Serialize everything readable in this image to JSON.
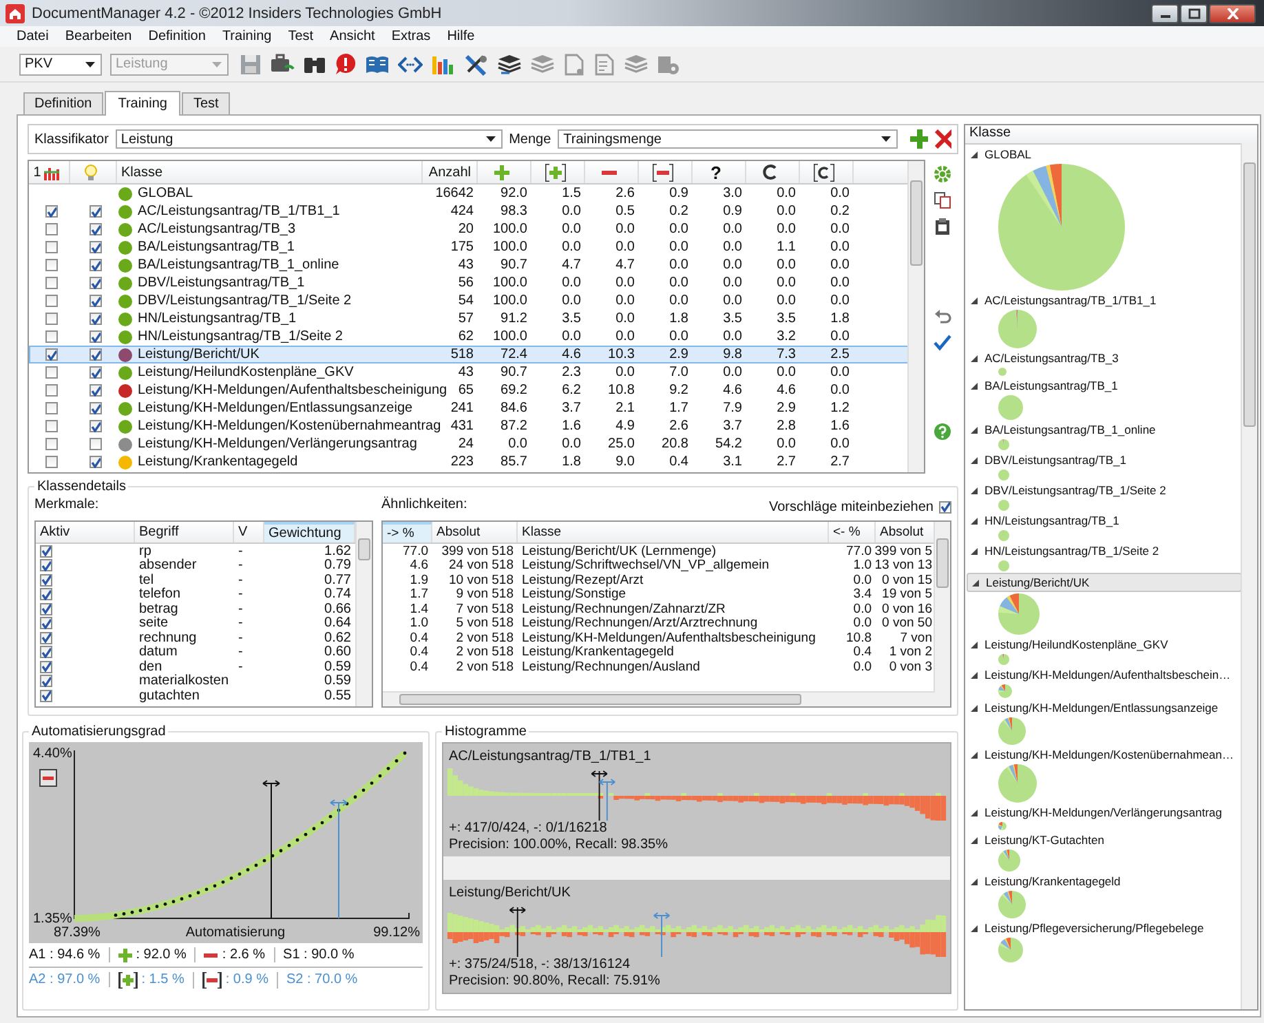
{
  "window": {
    "title": "DocumentManager 4.2 - ©2012 Insiders Technologies GmbH"
  },
  "menu": [
    "Datei",
    "Bearbeiten",
    "Definition",
    "Training",
    "Test",
    "Ansicht",
    "Extras",
    "Hilfe"
  ],
  "toolbar": {
    "combos": [
      {
        "value": "PKV",
        "disabled": false
      },
      {
        "value": "Leistung",
        "disabled": true
      }
    ]
  },
  "tabs": [
    {
      "label": "Definition",
      "selected": false
    },
    {
      "label": "Training",
      "selected": true
    },
    {
      "label": "Test",
      "selected": false
    }
  ],
  "classifier": {
    "label": "Klassifikator",
    "value": "Leistung",
    "set_label": "Menge",
    "set_value": "Trainingsmenge"
  },
  "table": {
    "columns": [
      {
        "kind": "count-icon",
        "label": "1"
      },
      {
        "kind": "bulb"
      },
      {
        "kind": "text",
        "label": "Klasse"
      },
      {
        "kind": "text",
        "label": "Anzahl"
      },
      {
        "kind": "plus"
      },
      {
        "kind": "plus-boxed"
      },
      {
        "kind": "minus"
      },
      {
        "kind": "minus-boxed"
      },
      {
        "kind": "text",
        "label": "?"
      },
      {
        "kind": "c"
      },
      {
        "kind": "c-boxed"
      }
    ],
    "rows": [
      {
        "kind": "total",
        "name": "GLOBAL",
        "color": "#6aaa1a",
        "count": "16642",
        "values": [
          "92.0",
          "1.5",
          "2.6",
          "0.9",
          "3.0",
          "0.0",
          "0.0"
        ],
        "selected": false
      },
      {
        "kind": "class",
        "name": "AC/Leistungsantrag/TB_1/TB1_1",
        "color": "#6aaa1a",
        "count": "424",
        "values": [
          "98.3",
          "0.0",
          "0.5",
          "0.2",
          "0.9",
          "0.0",
          "0.2"
        ],
        "checked_1": true,
        "checked_2": true,
        "selected": false
      },
      {
        "kind": "class",
        "name": "AC/Leistungsantrag/TB_3",
        "color": "#6aaa1a",
        "count": "20",
        "values": [
          "100.0",
          "0.0",
          "0.0",
          "0.0",
          "0.0",
          "0.0",
          "0.0"
        ],
        "checked_1": false,
        "checked_2": true,
        "selected": false
      },
      {
        "kind": "class",
        "name": "BA/Leistungsantrag/TB_1",
        "color": "#6aaa1a",
        "count": "175",
        "values": [
          "100.0",
          "0.0",
          "0.0",
          "0.0",
          "0.0",
          "1.1",
          "0.0"
        ],
        "checked_1": false,
        "checked_2": true,
        "selected": false
      },
      {
        "kind": "class",
        "name": "BA/Leistungsantrag/TB_1_online",
        "color": "#6aaa1a",
        "count": "43",
        "values": [
          "90.7",
          "4.7",
          "4.7",
          "0.0",
          "0.0",
          "0.0",
          "0.0"
        ],
        "checked_1": false,
        "checked_2": true,
        "selected": false
      },
      {
        "kind": "class",
        "name": "DBV/Leistungsantrag/TB_1",
        "color": "#6aaa1a",
        "count": "56",
        "values": [
          "100.0",
          "0.0",
          "0.0",
          "0.0",
          "0.0",
          "0.0",
          "0.0"
        ],
        "checked_1": false,
        "checked_2": true,
        "selected": false
      },
      {
        "kind": "class",
        "name": "DBV/Leistungsantrag/TB_1/Seite 2",
        "color": "#6aaa1a",
        "count": "54",
        "values": [
          "100.0",
          "0.0",
          "0.0",
          "0.0",
          "0.0",
          "0.0",
          "0.0"
        ],
        "checked_1": false,
        "checked_2": true,
        "selected": false
      },
      {
        "kind": "class",
        "name": "HN/Leistungsantrag/TB_1",
        "color": "#6aaa1a",
        "count": "57",
        "values": [
          "91.2",
          "3.5",
          "0.0",
          "1.8",
          "3.5",
          "3.5",
          "1.8"
        ],
        "checked_1": false,
        "checked_2": true,
        "selected": false
      },
      {
        "kind": "class",
        "name": "HN/Leistungsantrag/TB_1/Seite 2",
        "color": "#6aaa1a",
        "count": "62",
        "values": [
          "100.0",
          "0.0",
          "0.0",
          "0.0",
          "0.0",
          "3.2",
          "0.0"
        ],
        "checked_1": false,
        "checked_2": true,
        "selected": false
      },
      {
        "kind": "class",
        "name": "Leistung/Bericht/UK",
        "color": "#8e4a6e",
        "count": "518",
        "values": [
          "72.4",
          "4.6",
          "10.3",
          "2.9",
          "9.8",
          "7.3",
          "2.5"
        ],
        "checked_1": true,
        "checked_2": true,
        "selected": true
      },
      {
        "kind": "class",
        "name": "Leistung/HeilundKostenpläne_GKV",
        "color": "#6aaa1a",
        "count": "43",
        "values": [
          "90.7",
          "2.3",
          "0.0",
          "7.0",
          "0.0",
          "0.0",
          "0.0"
        ],
        "checked_1": false,
        "checked_2": true,
        "selected": false
      },
      {
        "kind": "class",
        "name": "Leistung/KH-Meldungen/Aufenthaltsbescheinigung",
        "color": "#c62828",
        "count": "65",
        "values": [
          "69.2",
          "6.2",
          "10.8",
          "9.2",
          "4.6",
          "4.6",
          "0.0"
        ],
        "checked_1": false,
        "checked_2": true,
        "selected": false
      },
      {
        "kind": "class",
        "name": "Leistung/KH-Meldungen/Entlassungsanzeige",
        "color": "#6aaa1a",
        "count": "241",
        "values": [
          "84.6",
          "3.7",
          "2.1",
          "1.7",
          "7.9",
          "2.9",
          "1.2"
        ],
        "checked_1": false,
        "checked_2": true,
        "selected": false
      },
      {
        "kind": "class",
        "name": "Leistung/KH-Meldungen/Kostenübernahmeantrag",
        "color": "#6aaa1a",
        "count": "431",
        "values": [
          "87.2",
          "1.6",
          "4.9",
          "2.6",
          "3.7",
          "2.8",
          "1.6"
        ],
        "checked_1": false,
        "checked_2": true,
        "selected": false
      },
      {
        "kind": "class",
        "name": "Leistung/KH-Meldungen/Verlängerungsantrag",
        "color": "#8c8c8c",
        "count": "24",
        "values": [
          "0.0",
          "0.0",
          "25.0",
          "20.8",
          "54.2",
          "0.0",
          "0.0"
        ],
        "checked_1": false,
        "checked_2": false,
        "selected": false
      },
      {
        "kind": "class",
        "name": "Leistung/Krankentagegeld",
        "color": "#f5b800",
        "count": "223",
        "values": [
          "85.7",
          "1.8",
          "9.0",
          "0.4",
          "3.1",
          "2.7",
          "2.7"
        ],
        "checked_1": false,
        "checked_2": true,
        "selected": false
      }
    ]
  },
  "details": {
    "title": "Klassendetails",
    "features_label": "Merkmale:",
    "features_columns": [
      {
        "label": "Aktiv",
        "sorted": false
      },
      {
        "label": "Begriff",
        "sorted": false
      },
      {
        "label": "V",
        "sorted": false
      },
      {
        "label": "Gewichtung",
        "sorted": true
      }
    ],
    "features": [
      {
        "checked": true,
        "term": "rp",
        "v": "-",
        "weight": "1.62"
      },
      {
        "checked": true,
        "term": "absender",
        "v": "-",
        "weight": "0.79"
      },
      {
        "checked": true,
        "term": "tel",
        "v": "-",
        "weight": "0.77"
      },
      {
        "checked": true,
        "term": "telefon",
        "v": "-",
        "weight": "0.74"
      },
      {
        "checked": true,
        "term": "betrag",
        "v": "-",
        "weight": "0.66"
      },
      {
        "checked": true,
        "term": "seite",
        "v": "-",
        "weight": "0.64"
      },
      {
        "checked": true,
        "term": "rechnung",
        "v": "-",
        "weight": "0.62"
      },
      {
        "checked": true,
        "term": "datum",
        "v": "-",
        "weight": "0.60"
      },
      {
        "checked": true,
        "term": "den",
        "v": "-",
        "weight": "0.59"
      },
      {
        "checked": true,
        "term": "materialkosten",
        "weight": "0.59"
      },
      {
        "checked": true,
        "term": "gutachten",
        "weight": "0.55"
      }
    ],
    "similar_label": "Ähnlichkeiten:",
    "suggest_label": "Vorschläge miteinbeziehen",
    "suggest_checked": true,
    "similar_columns": [
      {
        "label": "-> %",
        "sorted": true
      },
      {
        "label": "Absolut",
        "sorted": false
      },
      {
        "label": "Klasse",
        "sorted": false
      },
      {
        "label": "<- %",
        "sorted": false
      },
      {
        "label": "Absolut",
        "sorted": false
      }
    ],
    "similar": [
      {
        "pct_to": "77.0",
        "abs_to": "399 von 518",
        "class": "Leistung/Bericht/UK (Lernmenge)",
        "pct_from": "77.0",
        "abs_from": "399 von 5"
      },
      {
        "pct_to": "4.6",
        "abs_to": "24 von 518",
        "class": "Leistung/Schriftwechsel/VN_VP_allgemein",
        "pct_from": "1.0",
        "abs_from": "13 von 13"
      },
      {
        "pct_to": "1.9",
        "abs_to": "10 von 518",
        "class": "Leistung/Rezept/Arzt",
        "pct_from": "0.0",
        "abs_from": "0 von 15"
      },
      {
        "pct_to": "1.7",
        "abs_to": "9 von 518",
        "class": "Leistung/Sonstige",
        "pct_from": "3.4",
        "abs_from": "19 von 5"
      },
      {
        "pct_to": "1.4",
        "abs_to": "7 von 518",
        "class": "Leistung/Rechnungen/Zahnarzt/ZR",
        "pct_from": "0.0",
        "abs_from": "0 von 16"
      },
      {
        "pct_to": "1.0",
        "abs_to": "5 von 518",
        "class": "Leistung/Rechnungen/Arzt/Arztrechnung",
        "pct_from": "0.0",
        "abs_from": "0 von 50"
      },
      {
        "pct_to": "0.4",
        "abs_to": "2 von 518",
        "class": "Leistung/KH-Meldungen/Aufenthaltsbescheinigung",
        "pct_from": "10.8",
        "abs_from": "7 von"
      },
      {
        "pct_to": "0.4",
        "abs_to": "2 von 518",
        "class": "Leistung/Krankentagegeld",
        "pct_from": "0.4",
        "abs_from": "1 von 2"
      },
      {
        "pct_to": "0.4",
        "abs_to": "2 von 518",
        "class": "Leistung/Rechnungen/Ausland",
        "pct_from": "0.0",
        "abs_from": "0 von 3"
      }
    ]
  },
  "automation": {
    "title": "Automatisierungsgrad",
    "y_max": "4.40%",
    "y_min": "1.35%",
    "x_min": "87.39%",
    "x_max": "99.12%",
    "xlabel": "Automatisierung",
    "stats": [
      {
        "kind": "primary",
        "items": [
          {
            "kind": "label",
            "text": "A1 : 94.6 %"
          },
          {
            "kind": "plus",
            "text": ": 92.0 %"
          },
          {
            "kind": "minus",
            "text": ": 2.6 %"
          },
          {
            "kind": "label",
            "text": "S1 : 90.0 %"
          }
        ]
      },
      {
        "kind": "secondary",
        "items": [
          {
            "kind": "label",
            "text": "A2 : 97.0 %"
          },
          {
            "kind": "bracketed-plus",
            "text": ": 1.5 %"
          },
          {
            "kind": "bracketed-minus",
            "text": ": 0.9 %"
          },
          {
            "kind": "label",
            "text": "S2 : 70.0 %"
          }
        ]
      }
    ]
  },
  "histograms": {
    "title": "Histogramme",
    "items": [
      {
        "name": "AC/Leistungsantrag/TB_1/TB1_1",
        "counts": "+: 417/0/424, -: 0/1/16218",
        "metrics": "Precision: 100.00%, Recall: 98.35%"
      },
      {
        "name": "Leistung/Bericht/UK",
        "counts": "+: 375/24/518, -: 38/13/16124",
        "metrics": "Precision: 90.80%, Recall: 75.91%"
      }
    ]
  },
  "class_tree": {
    "header": "Klasse",
    "items": [
      {
        "label": "GLOBAL",
        "expanded": true,
        "selected": false
      },
      {
        "label": "AC/Leistungsantrag/TB_1/TB1_1",
        "expanded": true,
        "selected": false
      },
      {
        "label": "AC/Leistungsantrag/TB_3",
        "expanded": true,
        "selected": false
      },
      {
        "label": "BA/Leistungsantrag/TB_1",
        "expanded": true,
        "selected": false
      },
      {
        "label": "BA/Leistungsantrag/TB_1_online",
        "expanded": true,
        "selected": false
      },
      {
        "label": "DBV/Leistungsantrag/TB_1",
        "expanded": true,
        "selected": false
      },
      {
        "label": "DBV/Leistungsantrag/TB_1/Seite 2",
        "expanded": true,
        "selected": false
      },
      {
        "label": "HN/Leistungsantrag/TB_1",
        "expanded": true,
        "selected": false
      },
      {
        "label": "HN/Leistungsantrag/TB_1/Seite 2",
        "expanded": true,
        "selected": false
      },
      {
        "label": "Leistung/Bericht/UK",
        "expanded": true,
        "selected": true
      },
      {
        "label": "Leistung/HeilundKostenpläne_GKV",
        "expanded": true,
        "selected": false
      },
      {
        "label": "Leistung/KH-Meldungen/Aufenthaltsbeschein…",
        "expanded": true,
        "selected": false
      },
      {
        "label": "Leistung/KH-Meldungen/Entlassungsanzeige",
        "expanded": true,
        "selected": false
      },
      {
        "label": "Leistung/KH-Meldungen/Kostenübernahmean…",
        "expanded": true,
        "selected": false
      },
      {
        "label": "Leistung/KH-Meldungen/Verlängerungsantrag",
        "expanded": true,
        "selected": false
      },
      {
        "label": "Leistung/KT-Gutachten",
        "expanded": true,
        "selected": false
      },
      {
        "label": "Leistung/Krankentagegeld",
        "expanded": true,
        "selected": false
      },
      {
        "label": "Leistung/Pflegeversicherung/Pflegebelege",
        "expanded": true,
        "selected": false
      }
    ]
  }
}
